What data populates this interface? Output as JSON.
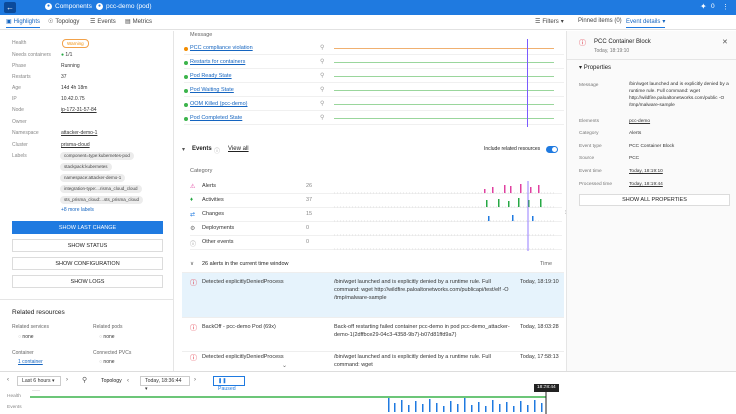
{
  "topbar": {
    "home": "Components",
    "resource": "pcc-demo (pod)",
    "count": "0"
  },
  "tabs": [
    {
      "label": "Highlights"
    },
    {
      "label": "Topology"
    },
    {
      "label": "Events"
    },
    {
      "label": "Metrics"
    }
  ],
  "filters": "Filters",
  "right_tabs": {
    "pinned": "Pinned items (0)",
    "details": "Event details"
  },
  "left": {
    "props": [
      {
        "k": "Health",
        "v": "Warning"
      },
      {
        "k": "Needs containers",
        "v": "1/1"
      },
      {
        "k": "Phase",
        "v": "Running"
      },
      {
        "k": "Restarts",
        "v": "37"
      },
      {
        "k": "Age",
        "v": "14d 4h 18m"
      },
      {
        "k": "IP",
        "v": "10.42.0.75"
      },
      {
        "k": "Node",
        "v": "ip-172-31-57-84"
      },
      {
        "k": "Owner",
        "v": ""
      },
      {
        "k": "Namespace",
        "v": "attacker-demo-1"
      },
      {
        "k": "Cluster",
        "v": "prisma-cloud"
      },
      {
        "k": "Labels",
        "v": ""
      }
    ],
    "labels": [
      "component=type:kubernetes-pod",
      "stackpack:kubernetes",
      "namespace:attacker-demo-1",
      "integration-type:...risma_cloud_cloud",
      "sts_prisma_cloud:...sts_prisma_cloud"
    ],
    "more_labels": "+8 more labels",
    "buttons": [
      "SHOW LAST CHANGE",
      "SHOW STATUS",
      "SHOW CONFIGURATION",
      "SHOW LOGS"
    ],
    "related_title": "Related resources",
    "related": [
      {
        "k": "Related services",
        "v": "none"
      },
      {
        "k": "Related pods",
        "v": "none"
      },
      {
        "k": "Container",
        "v": "1 container"
      },
      {
        "k": "Connected PVCs",
        "v": "none"
      }
    ]
  },
  "messages": {
    "header": "Message",
    "rows": [
      "PCC compliance violation",
      "Restarts for containers",
      "Pod Ready State",
      "Pod Waiting State",
      "OOM Killed (pcc-demo)",
      "Pod Completed State"
    ]
  },
  "events": {
    "title": "Events",
    "view_all": "View all",
    "include": "Include related resources",
    "category": "Category",
    "cats": [
      {
        "name": "Alerts",
        "count": "26"
      },
      {
        "name": "Activities",
        "count": "37"
      },
      {
        "name": "Changes",
        "count": "15"
      },
      {
        "name": "Deployments",
        "count": "0"
      },
      {
        "name": "Other events",
        "count": "0"
      }
    ],
    "summary": "26 alerts in the current time window",
    "time_label": "Time",
    "rows": [
      {
        "title": "Detected explicitlyDeniedProcess",
        "detail": "/bin/wget launched and is explicitly denied by a runtime rule. Full command: wget http://wildfire.paloaltonetworks.com/publicapi/test/elf -O /tmp/malware-sample",
        "time": "Today, 18:19:10"
      },
      {
        "title": "BackOff - pcc-demo Pod (69x)",
        "detail": "Back-off restarting failed container pcc-demo in pod pcc-demo_attacker-demo-1(2dffbce29-04c3-4358-9b7)-b07d81ffd9a7)",
        "time": "Today, 18:03:28"
      },
      {
        "title": "Detected explicitlyDeniedProcess",
        "detail": "/bin/wget launched and is explicitly denied by a runtime rule. Full command: wget",
        "time": "Today, 17:58:13"
      }
    ]
  },
  "details": {
    "title": "PCC Container Block",
    "time": "Today, 18:19:10",
    "properties": "Properties",
    "items": [
      {
        "k": "Message",
        "v": "/bin/wget launched and is explicitly denied by a runtime rule. Full command: wget http://wildfire.paloaltonetworks.com/public -O /tmp/malware-sample"
      },
      {
        "k": "Elements",
        "v": "pcc-demo"
      },
      {
        "k": "Category",
        "v": "Alerts"
      },
      {
        "k": "Event type",
        "v": "PCC Container Block"
      },
      {
        "k": "Source",
        "v": "PCC"
      },
      {
        "k": "Event time",
        "v": "Today, 18:19:10"
      },
      {
        "k": "Processed time",
        "v": "Today, 18:19:44"
      }
    ],
    "show_all": "SHOW ALL PROPERTIES"
  },
  "timeline": {
    "range": "Last 6 hours",
    "topology": "Topology",
    "date": "Today, 18:36:44",
    "paused": "Paused",
    "now": "18:38:44",
    "rows": [
      "Health",
      "Events"
    ]
  },
  "colors": {
    "accent": "#1f7ae0",
    "alerts": "#e040a0",
    "activities": "#27a844",
    "changes": "#1f7ae0"
  }
}
